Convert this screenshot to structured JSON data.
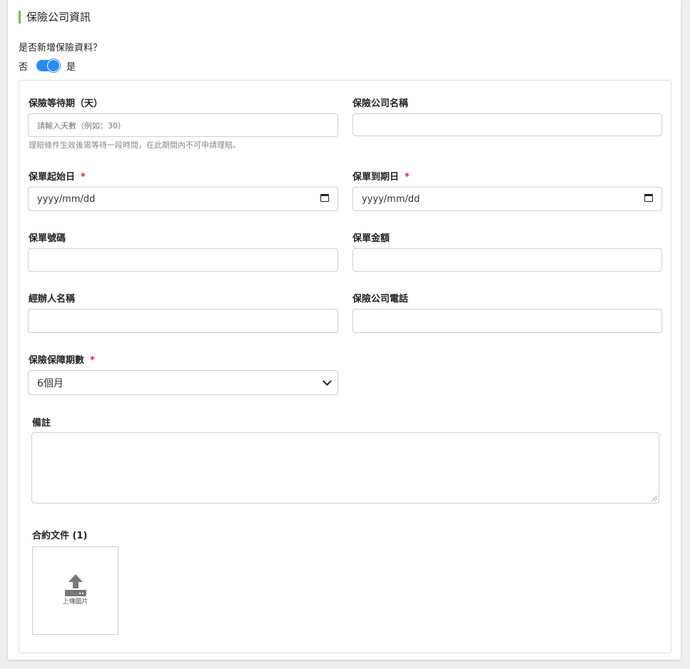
{
  "section": {
    "title": "保險公司資訊"
  },
  "toggle": {
    "question": "是否新增保險資料？",
    "off_label": "否",
    "on_label": "是",
    "state": "on",
    "color": "#2a8cf0"
  },
  "fields": {
    "waiting_period": {
      "label": "保險等待期（天）",
      "placeholder": "請輸入天數（例如：30）",
      "hint": "理賠條件生效後需等待一段時間，在此期間內不可申請理賠。"
    },
    "company_name": {
      "label": "保險公司名稱",
      "value": ""
    },
    "start_date": {
      "label": "保單起始日",
      "required_mark": "*",
      "value": "yyyy/mm/dd"
    },
    "end_date": {
      "label": "保單到期日",
      "required_mark": "*",
      "value": "yyyy/mm/dd"
    },
    "policy_number": {
      "label": "保單號碼",
      "value": ""
    },
    "policy_amount": {
      "label": "保單金額",
      "value": ""
    },
    "agent_name": {
      "label": "經辦人名稱",
      "value": ""
    },
    "company_phone": {
      "label": "保險公司電話",
      "value": ""
    },
    "coverage_terms": {
      "label": "保險保障期數",
      "required_mark": "*",
      "selected": "6個月"
    },
    "notes": {
      "label": "備註",
      "value": ""
    },
    "contract_files": {
      "label": "合約文件 (1)",
      "upload_label": "上傳圖片"
    }
  },
  "colors": {
    "accent": "#7dbb3c",
    "required": "#d9262b",
    "toggle": "#2a8cf0"
  }
}
